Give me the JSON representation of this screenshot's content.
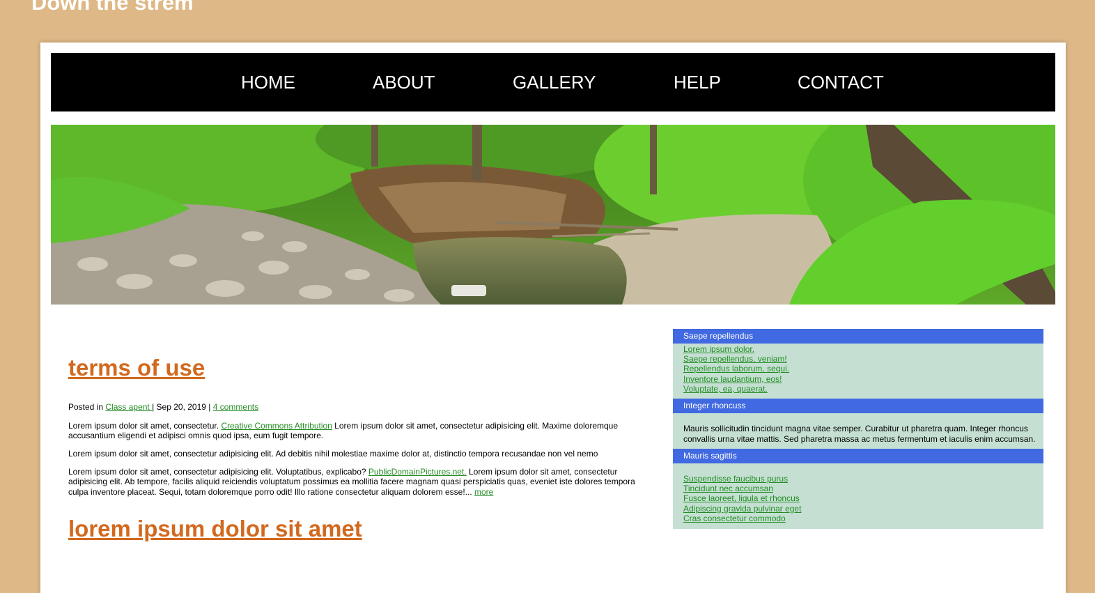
{
  "site": {
    "title": "Down the strem"
  },
  "nav": {
    "items": [
      {
        "label": "HOME"
      },
      {
        "label": "ABOUT"
      },
      {
        "label": "GALLERY"
      },
      {
        "label": "HELP"
      },
      {
        "label": "CONTACT"
      }
    ]
  },
  "colors": {
    "background": "#dfb887",
    "nav_bg": "#000000",
    "title_accent": "#d2691e",
    "link": "#228b22",
    "sidebar_header": "#4169e1",
    "sidebar_body": "#c5e0d3"
  },
  "banner": {
    "icon": "forest-stream-photo"
  },
  "posts": [
    {
      "title": "terms of use",
      "meta": {
        "prefix": "Posted in ",
        "category": "Class apent ",
        "date": "| Sep 20, 2019 | ",
        "comments": "4 comments"
      },
      "p1": {
        "a": "Lorem ipsum dolor sit amet, consectetur. ",
        "link": "Creative Commons Attribution",
        "b": " Lorem ipsum dolor sit amet, consectetur adipisicing elit. Maxime doloremque accusantium eligendi et adipisci omnis quod ipsa, eum fugit tempore."
      },
      "p2": "Lorem ipsum dolor sit amet, consectetur adipisicing elit. Ad debitis nihil molestiae maxime dolor at, distinctio tempora recusandae non vel nemo",
      "p3": {
        "a": "Lorem ipsum dolor sit amet, consectetur adipisicing elit. Voluptatibus, explicabo? ",
        "link": "PublicDomainPictures.net.",
        "b": " Lorem ipsum dolor sit amet, consectetur adipisicing elit. Ab tempore, facilis aliquid reiciendis voluptatum possimus ea mollitia facere magnam quasi perspiciatis quas, eveniet iste dolores tempora culpa inventore placeat. Sequi, totam doloremque porro odit! Illo ratione consectetur aliquam dolorem esse!... ",
        "more": "more"
      }
    },
    {
      "title": "lorem ipsum dolor sit amet"
    }
  ],
  "sidebar": {
    "sections": [
      {
        "title": "Saepe repellendus",
        "links": [
          "Lorem ipsum dolor.",
          "Saepe repellendus, veniam!",
          "Repellendus laborum, sequi.",
          "Inventore laudantium, eos!",
          "Voluptate, ea, quaerat."
        ]
      },
      {
        "title": "Integer rhoncuss",
        "text": "Mauris sollicitudin tincidunt magna vitae semper. Curabitur ut pharetra quam. Integer rhoncus convallis urna vitae mattis. Sed pharetra massa ac metus fermentum et iaculis enim accumsan."
      },
      {
        "title": "Mauris sagittis",
        "links": [
          "Suspendisse faucibus purus",
          "Tincidunt nec accumsan",
          "Fusce laoreet, ligula et rhoncus",
          "Adipiscing gravida pulvinar eget",
          "Cras consectetur commodo"
        ]
      }
    ]
  }
}
